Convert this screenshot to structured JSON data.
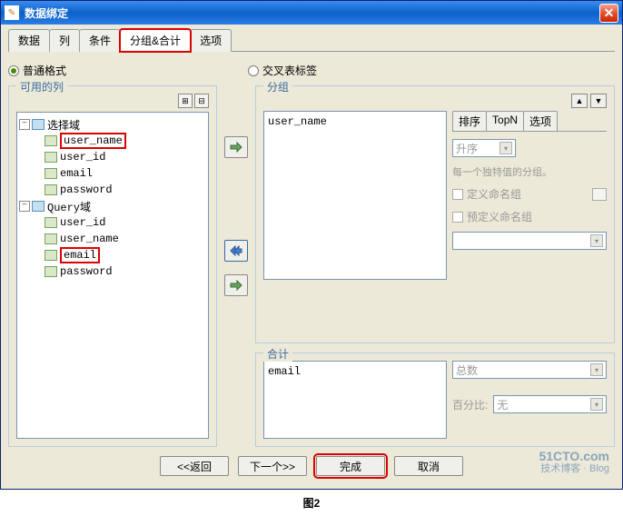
{
  "window": {
    "title": "数据绑定"
  },
  "tabs": [
    "数据",
    "列",
    "条件",
    "分组&合计",
    "选项"
  ],
  "active_tab_index": 3,
  "format": {
    "normal": "普通格式",
    "cross": "交叉表标签"
  },
  "left": {
    "legend": "可用的列",
    "tree": [
      {
        "level": 0,
        "toggle": "-",
        "type": "folder",
        "label": "选择域"
      },
      {
        "level": 1,
        "toggle": "",
        "type": "leaf",
        "label": "user_name",
        "highlight": true
      },
      {
        "level": 1,
        "toggle": "",
        "type": "leaf",
        "label": "user_id"
      },
      {
        "level": 1,
        "toggle": "",
        "type": "leaf",
        "label": "email"
      },
      {
        "level": 1,
        "toggle": "",
        "type": "leaf",
        "label": "password"
      },
      {
        "level": 0,
        "toggle": "-",
        "type": "folder",
        "label": "Query域"
      },
      {
        "level": 1,
        "toggle": "",
        "type": "leaf",
        "label": "user_id"
      },
      {
        "level": 1,
        "toggle": "",
        "type": "leaf",
        "label": "user_name"
      },
      {
        "level": 1,
        "toggle": "",
        "type": "leaf",
        "label": "email",
        "highlight": true
      },
      {
        "level": 1,
        "toggle": "",
        "type": "leaf",
        "label": "password"
      }
    ]
  },
  "group": {
    "legend": "分组",
    "item": "user_name",
    "subtabs": [
      "排序",
      "TopN",
      "选项"
    ],
    "sort_value": "升序",
    "hint": "每一个独特值的分组。",
    "chk_custom": "定义命名组",
    "chk_predef": "预定义命名组"
  },
  "total": {
    "legend": "合计",
    "item": "email",
    "agg_label": "总数",
    "pct_label": "百分比:",
    "pct_value": "无"
  },
  "footer": {
    "back": "<<返回",
    "next": "下一个>>",
    "finish": "完成",
    "cancel": "取消"
  },
  "watermark": {
    "line1": "51CTO.com",
    "line2": "技术博客 · Blog"
  },
  "caption": "图2"
}
